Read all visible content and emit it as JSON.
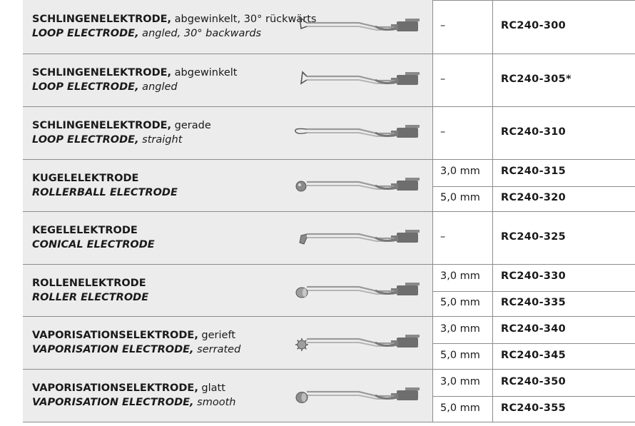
{
  "rows": [
    {
      "de_bold": "SCHLINGENELEKTRODE,",
      "de_rest": " abgewinkelt, 30° rückwärts",
      "en_bold": "LOOP ELECTRODE,",
      "en_rest": " angled, 30° backwards",
      "variants": [
        {
          "dim": "–",
          "code": "RC240-300"
        }
      ],
      "tip": "loop-angled-back"
    },
    {
      "de_bold": "SCHLINGENELEKTRODE,",
      "de_rest": " abgewinkelt",
      "en_bold": "LOOP ELECTRODE,",
      "en_rest": " angled",
      "variants": [
        {
          "dim": "–",
          "code": "RC240-305*"
        }
      ],
      "tip": "loop-angled"
    },
    {
      "de_bold": "SCHLINGENELEKTRODE,",
      "de_rest": " gerade",
      "en_bold": "LOOP ELECTRODE,",
      "en_rest": " straight",
      "variants": [
        {
          "dim": "–",
          "code": "RC240-310"
        }
      ],
      "tip": "loop-straight"
    },
    {
      "de_bold": "KUGELELEKTRODE",
      "de_rest": "",
      "en_bold": "ROLLERBALL ELECTRODE",
      "en_rest": "",
      "variants": [
        {
          "dim": "3,0 mm",
          "code": "RC240-315"
        },
        {
          "dim": "5,0 mm",
          "code": "RC240-320"
        }
      ],
      "tip": "ball"
    },
    {
      "de_bold": "KEGELELEKTRODE",
      "de_rest": "",
      "en_bold": "CONICAL ELECTRODE",
      "en_rest": "",
      "variants": [
        {
          "dim": "–",
          "code": "RC240-325"
        }
      ],
      "tip": "cone"
    },
    {
      "de_bold": "ROLLENELEKTRODE",
      "de_rest": "",
      "en_bold": "ROLLER ELECTRODE",
      "en_rest": "",
      "variants": [
        {
          "dim": "3,0 mm",
          "code": "RC240-330"
        },
        {
          "dim": "5,0 mm",
          "code": "RC240-335"
        }
      ],
      "tip": "roller"
    },
    {
      "de_bold": "VAPORISATIONSELEKTRODE,",
      "de_rest": " gerieft",
      "en_bold": "VAPORISATION ELECTRODE,",
      "en_rest": " serrated",
      "variants": [
        {
          "dim": "3,0 mm",
          "code": "RC240-340"
        },
        {
          "dim": "5,0 mm",
          "code": "RC240-345"
        }
      ],
      "tip": "serrated"
    },
    {
      "de_bold": "VAPORISATIONSELEKTRODE,",
      "de_rest": " glatt",
      "en_bold": "VAPORISATION ELECTRODE,",
      "en_rest": " smooth",
      "variants": [
        {
          "dim": "3,0 mm",
          "code": "RC240-350"
        },
        {
          "dim": "5,0 mm",
          "code": "RC240-355"
        }
      ],
      "tip": "smooth"
    }
  ],
  "colors": {
    "row_bg": "#ececec",
    "rule": "#8c8c8c",
    "steel": "#9a9a9a",
    "steel_dark": "#555555"
  }
}
